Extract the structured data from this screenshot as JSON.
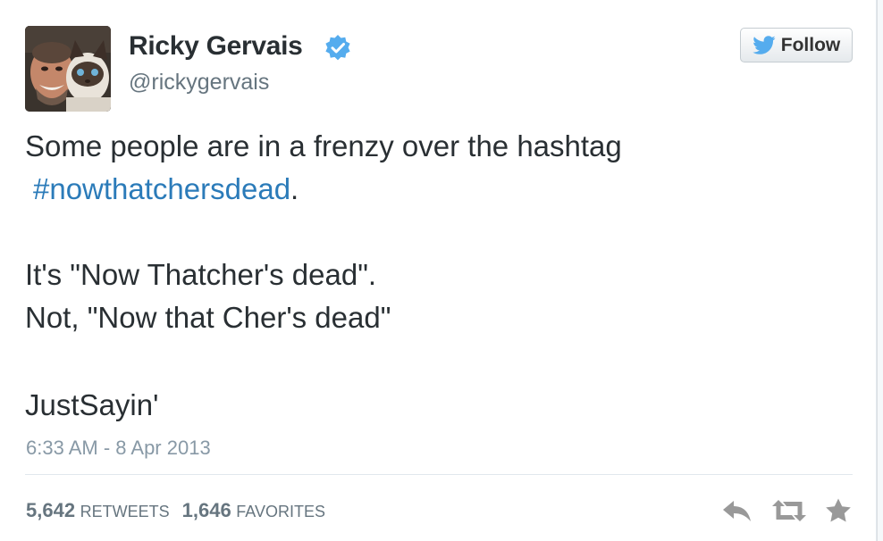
{
  "user": {
    "name": "Ricky Gervais",
    "handle": "@rickygervais"
  },
  "follow_button": {
    "label": "Follow"
  },
  "tweet": {
    "line1": "Some people are in a frenzy over the hashtag",
    "hashtag": "#nowthatchersdead",
    "hashtag_suffix": ".",
    "line3": "It's \"Now Thatcher's dead\".",
    "line4": "Not, \"Now that Cher's dead\"",
    "line5": "JustSayin'"
  },
  "timestamp": "6:33 AM - 8 Apr 2013",
  "stats": {
    "retweets_count": "5,642",
    "retweets_label": "RETWEETS",
    "favorites_count": "1,646",
    "favorites_label": "FAVORITES"
  },
  "icons": {
    "verified": "verified-badge-icon",
    "follow": "twitter-bird-icon",
    "reply": "reply-icon",
    "retweet": "retweet-icon",
    "favorite": "star-icon"
  },
  "colors": {
    "hashtag": "#2b7bb9",
    "verified": "#55acee",
    "text": "#292f33",
    "muted": "#8899a6",
    "action_icon": "#999999"
  }
}
